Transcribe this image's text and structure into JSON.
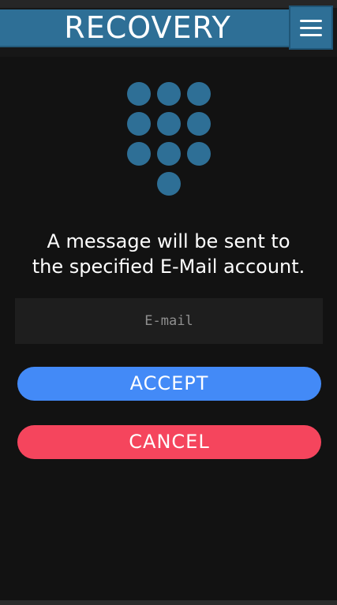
{
  "header": {
    "title": "RECOVERY",
    "menu_icon": "hamburger-menu-icon",
    "color": "#2e6f96"
  },
  "keypad": {
    "icon": "dial-pad-icon",
    "color": "#2e6f96",
    "dot_count": 10
  },
  "main": {
    "message_line1": "A message will be sent to",
    "message_line2": "the specified E-Mail account.",
    "email": {
      "placeholder": "E-mail",
      "value": ""
    }
  },
  "buttons": {
    "accept_label": "ACCEPT",
    "accept_color": "#438af7",
    "cancel_label": "CANCEL",
    "cancel_color": "#f5455d"
  }
}
